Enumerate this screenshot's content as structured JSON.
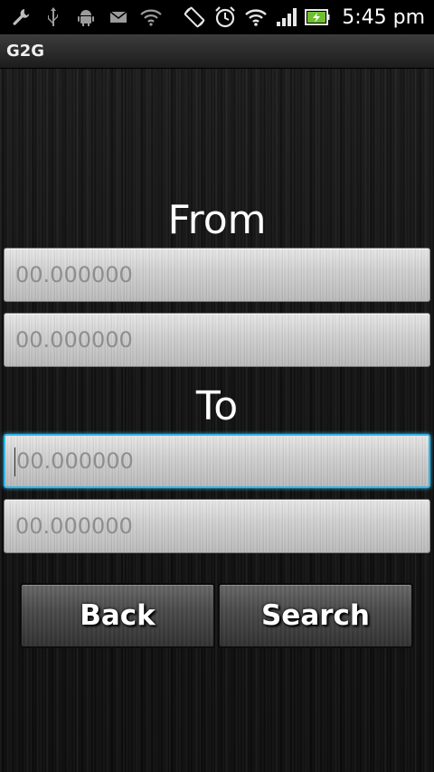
{
  "status_bar": {
    "time": "5:45 pm",
    "notification_icons": [
      "wrench-icon",
      "usb-icon",
      "android-debug-icon",
      "email-icon",
      "wifi-available-icon"
    ],
    "system_icons": [
      "screen-rotation-icon",
      "alarm-clock-icon",
      "wifi-icon",
      "signal-strength-icon",
      "battery-charging-icon"
    ]
  },
  "app": {
    "title": "G2G"
  },
  "from": {
    "label": "From",
    "latitude": {
      "value": "",
      "placeholder": "00.000000"
    },
    "longitude": {
      "value": "",
      "placeholder": "00.000000"
    }
  },
  "to": {
    "label": "To",
    "latitude": {
      "value": "",
      "placeholder": "00.000000"
    },
    "longitude": {
      "value": "",
      "placeholder": "00.000000"
    }
  },
  "buttons": {
    "back_label": "Back",
    "search_label": "Search"
  },
  "colors": {
    "focus_accent": "#33b5e5",
    "label_text": "#ffffff",
    "placeholder_text": "#8e8e8e"
  }
}
